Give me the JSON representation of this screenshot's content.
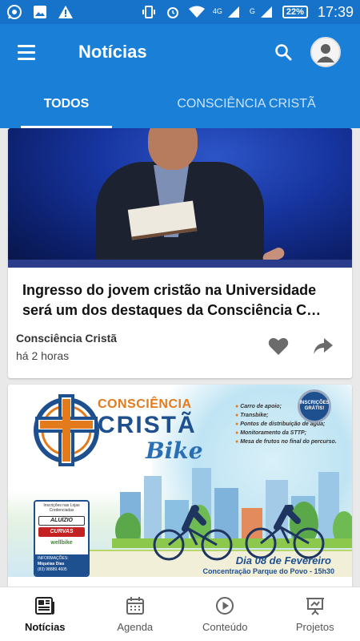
{
  "status_bar": {
    "network_4g": "4G",
    "network_g": "G",
    "battery": "22%",
    "time": "17:39"
  },
  "app_bar": {
    "title": "Notícias",
    "icons": [
      "menu-icon",
      "search-icon",
      "account-icon"
    ]
  },
  "tabs": [
    {
      "label": "TODOS",
      "active": true
    },
    {
      "label": "CONSCIÊNCIA CRISTÃ",
      "active": false
    }
  ],
  "feed": {
    "cards": [
      {
        "title": "Ingresso do jovem cristão na Universidade será um dos destaques da Consciência C…",
        "source": "Consciência Cristã",
        "time": "há 2 horas",
        "actions": [
          "heart-icon",
          "share-icon"
        ]
      },
      {
        "poster": {
          "title_line1": "CONSCIÊNCIA",
          "title_line2": "CRISTÃ",
          "title_line3": "Bike",
          "seal": "INSCRIÇÕES GRÁTIS!",
          "list": [
            "Carro de apoio;",
            "Transbike;",
            "Pontos de distribuição de água;",
            "Monitoramento da STTP;",
            "Mesa de frutos no final do percurso."
          ],
          "sponsor_header": "Inscrições nas Lojas Credenciadas",
          "sponsor_logos": [
            "ALUÍZIO",
            "CURVAS",
            "wellbike"
          ],
          "sponsor_info_label": "INFORMAÇÕES:",
          "sponsor_info_name": "Miquéias Dias",
          "sponsor_info_phone": "(83) 98889.4605",
          "date": "Dia 08 de Fevereiro",
          "place": "Concentração Parque do Povo - 15h30"
        }
      }
    ]
  },
  "bottom_nav": [
    {
      "label": "Notícias",
      "icon": "newspaper-icon",
      "active": true
    },
    {
      "label": "Agenda",
      "icon": "calendar-icon",
      "active": false
    },
    {
      "label": "Conteúdo",
      "icon": "play-circle-icon",
      "active": false
    },
    {
      "label": "Projetos",
      "icon": "presentation-icon",
      "active": false
    }
  ],
  "colors": {
    "primary": "#1a7fd6",
    "status_bar": "#1773c9",
    "accent_orange": "#e37b1d",
    "poster_blue": "#1e4f8f"
  }
}
